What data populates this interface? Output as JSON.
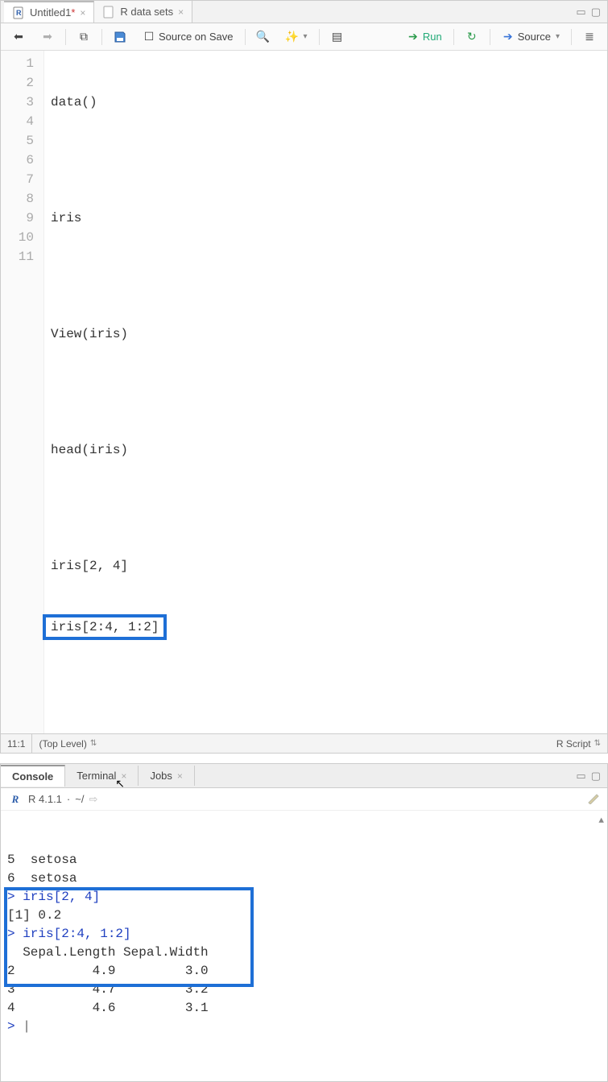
{
  "editor_pane": {
    "tabs": [
      {
        "icon": "r-doc-icon",
        "label": "Untitled1",
        "dirty": "*",
        "active": true
      },
      {
        "icon": "doc-icon",
        "label": "R data sets",
        "dirty": "",
        "active": false
      }
    ],
    "toolbar": {
      "source_on_save": "Source on Save",
      "run": "Run",
      "source": "Source"
    },
    "code": {
      "lines": [
        "data()",
        "",
        "iris",
        "",
        "View(iris)",
        "",
        "head(iris)",
        "",
        "iris[2, 4]",
        "iris[2:4, 1:2]",
        ""
      ]
    },
    "status": {
      "pos": "11:1",
      "scope": "(Top Level)",
      "lang": "R Script"
    }
  },
  "console_pane": {
    "tabs": {
      "console": "Console",
      "terminal": "Terminal",
      "jobs": "Jobs"
    },
    "header": {
      "version": "R 4.1.1",
      "path": "~/"
    },
    "output": {
      "line1": "5  setosa",
      "line2": "6  setosa",
      "cmd1": "iris[2, 4]",
      "res1": "[1] 0.2",
      "cmd2": "iris[2:4, 1:2]",
      "table_header": "  Sepal.Length Sepal.Width",
      "row1": "2          4.9         3.0",
      "row2": "3          4.7         3.2",
      "row3": "4          4.6         3.1"
    }
  }
}
